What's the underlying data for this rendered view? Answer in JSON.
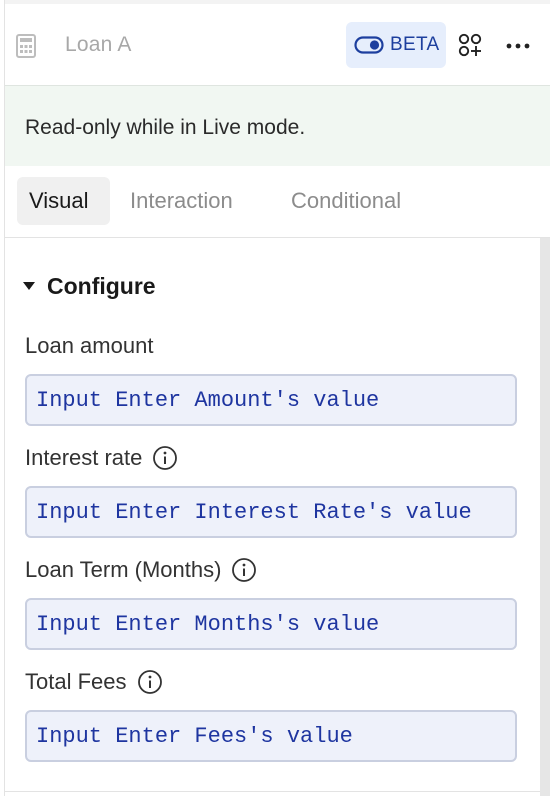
{
  "header": {
    "title": "Loan A",
    "beta_label": "BETA",
    "icons": {
      "component": "calculator-icon",
      "toggle": "toggle-icon",
      "shapes": "shapes-add-icon",
      "more": "more-horizontal-icon"
    }
  },
  "notice": {
    "text": "Read-only while in Live mode."
  },
  "tabs": [
    {
      "label": "Visual",
      "active": true
    },
    {
      "label": "Interaction",
      "active": false
    },
    {
      "label": "Conditional",
      "active": false
    }
  ],
  "configure": {
    "title": "Configure",
    "fields": [
      {
        "label": "Loan amount",
        "value": "Input Enter Amount's value",
        "has_info": false
      },
      {
        "label": "Interest rate",
        "value": "Input Enter Interest Rate's value",
        "has_info": true
      },
      {
        "label": "Loan Term (Months)",
        "value": "Input Enter Months's value",
        "has_info": true
      },
      {
        "label": "Total Fees",
        "value": "Input Enter Fees's value",
        "has_info": true
      }
    ]
  },
  "colors": {
    "accent": "#1d3f9e",
    "beta_bg": "#e6eefc",
    "notice_bg": "#f1f7f2",
    "input_bg": "#eef1fa",
    "input_text": "#1e35a0"
  }
}
